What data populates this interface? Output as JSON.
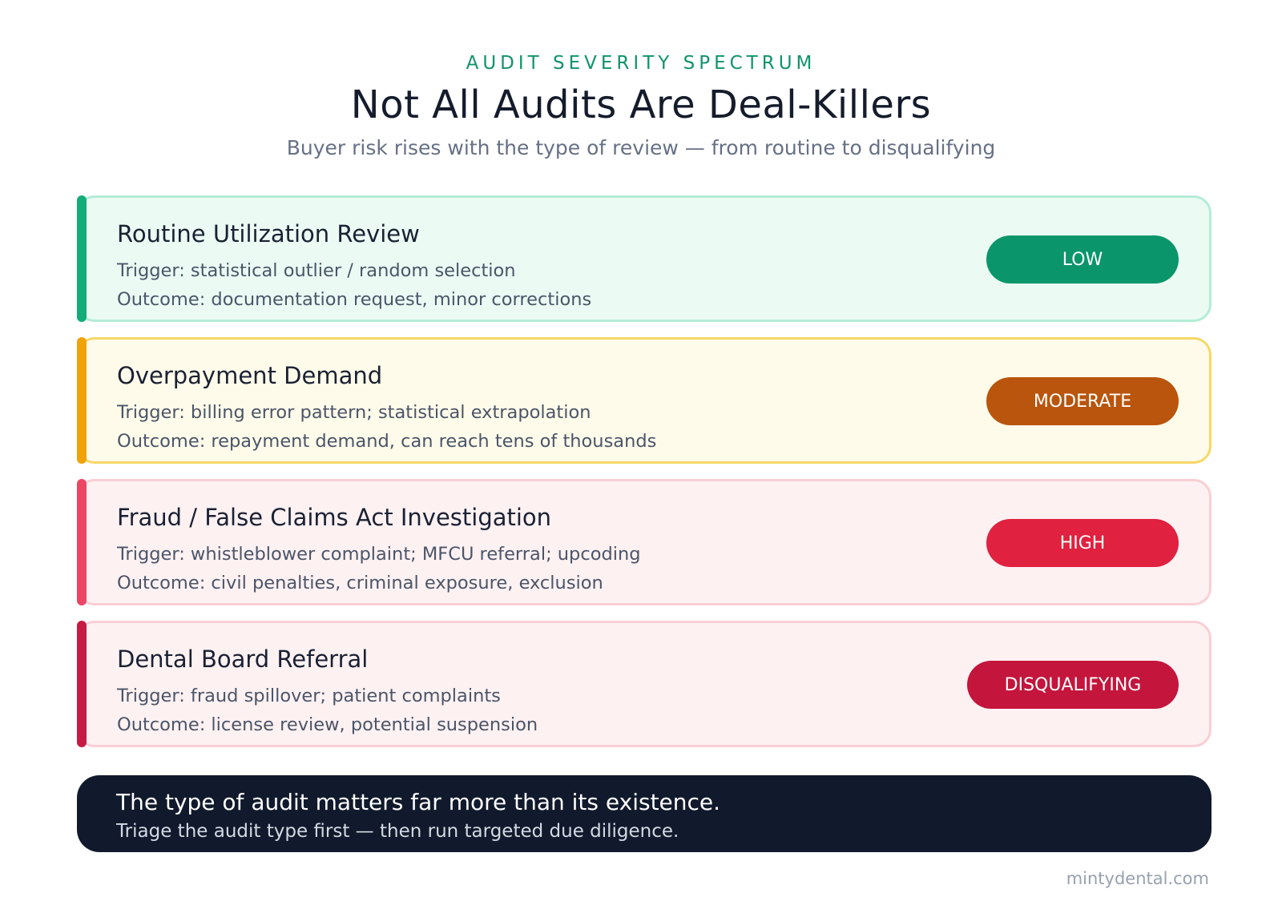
{
  "header": {
    "eyebrow": "AUDIT SEVERITY SPECTRUM",
    "title": "Not All Audits Are Deal-Killers",
    "subtitle": "Buyer risk rises with the type of review — from routine to disqualifying"
  },
  "tiers": [
    {
      "name": "Routine Utilization Review",
      "trigger": "Trigger: statistical outlier / random selection",
      "outcome": "Outcome: documentation request, minor corrections",
      "badge": "LOW",
      "accent": "#14ac78",
      "badge_color": "#0a966a"
    },
    {
      "name": "Overpayment Demand",
      "trigger": "Trigger: billing error pattern; statistical extrapolation",
      "outcome": "Outcome: repayment demand, can reach tens of thousands",
      "badge": "MODERATE",
      "accent": "#f1a208",
      "badge_color": "#b9550c"
    },
    {
      "name": "Fraud / False Claims Act Investigation",
      "trigger": "Trigger: whistleblower complaint; MFCU referral; upcoding",
      "outcome": "Outcome: civil penalties, criminal exposure, exclusion",
      "badge": "HIGH",
      "accent": "#ec4664",
      "badge_color": "#e0213f"
    },
    {
      "name": "Dental Board Referral",
      "trigger": "Trigger: fraud spillover; patient complaints",
      "outcome": "Outcome: license review, potential suspension",
      "badge": "DISQUALIFYING",
      "accent": "#c41c45",
      "badge_color": "#c4153c"
    }
  ],
  "callout": {
    "headline": "The type of audit matters far more than its existence.",
    "detail": "Triage the audit type first — then run targeted due diligence."
  },
  "footer": {
    "site": "mintydental.com"
  }
}
